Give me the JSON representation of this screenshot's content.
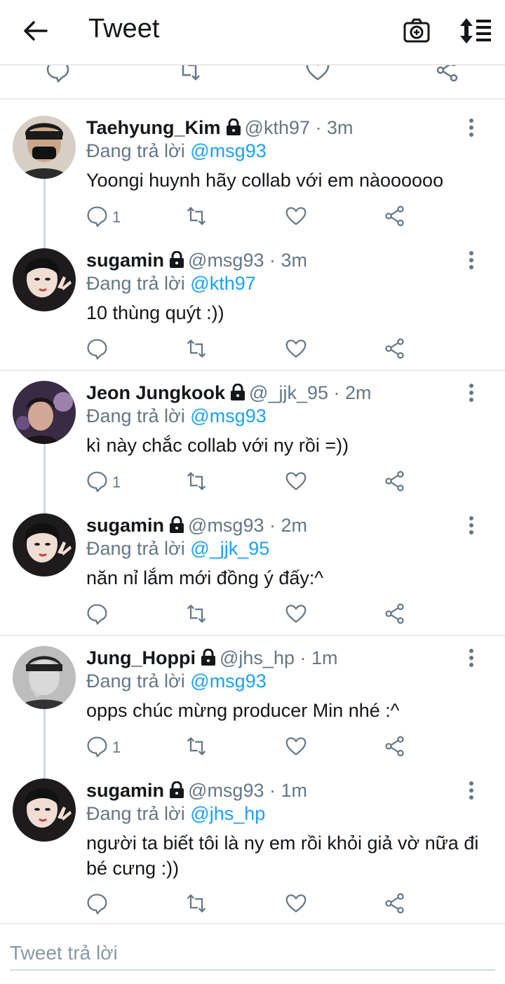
{
  "header": {
    "title": "Tweet"
  },
  "reply_prefix": "Đang trả lời",
  "composer": {
    "placeholder": "Tweet trả lời"
  },
  "colors": {
    "accent": "#1da1f2",
    "secondary": "#657786",
    "text": "#14171a"
  },
  "tweets": [
    {
      "name": "Taehyung_Kim",
      "handle": "@kth97",
      "time": "· 3m",
      "reply_to": "@msg93",
      "text": "Yoongi huynh hãy collab với em nàoooooo",
      "reply_count": "1",
      "avatar": "avatar-taehyung"
    },
    {
      "name": "sugamin",
      "handle": "@msg93",
      "time": "· 3m",
      "reply_to": "@kth97",
      "text": "10 thùng quýt :))",
      "reply_count": "",
      "avatar": "avatar-sugamin"
    },
    {
      "name": "Jeon Jungkook",
      "handle": "@_jjk_95",
      "time": "· 2m",
      "reply_to": "@msg93",
      "text": "kì này chắc collab với ny rồi =))",
      "reply_count": "1",
      "avatar": "avatar-jungkook"
    },
    {
      "name": "sugamin",
      "handle": "@msg93",
      "time": "· 2m",
      "reply_to": "@_jjk_95",
      "text": "năn nỉ lắm mới đồng ý đấy:^",
      "reply_count": "",
      "avatar": "avatar-sugamin"
    },
    {
      "name": "Jung_Hoppi",
      "handle": "@jhs_hp",
      "time": "· 1m",
      "reply_to": "@msg93",
      "text": "opps chúc mừng producer Min nhé :^",
      "reply_count": "1",
      "avatar": "avatar-hoppi"
    },
    {
      "name": "sugamin",
      "handle": "@msg93",
      "time": "· 1m",
      "reply_to": "@jhs_hp",
      "text": "người ta biết tôi là ny em rồi khỏi giả vờ nữa đi bé cưng :))",
      "reply_count": "",
      "avatar": "avatar-sugamin"
    }
  ]
}
